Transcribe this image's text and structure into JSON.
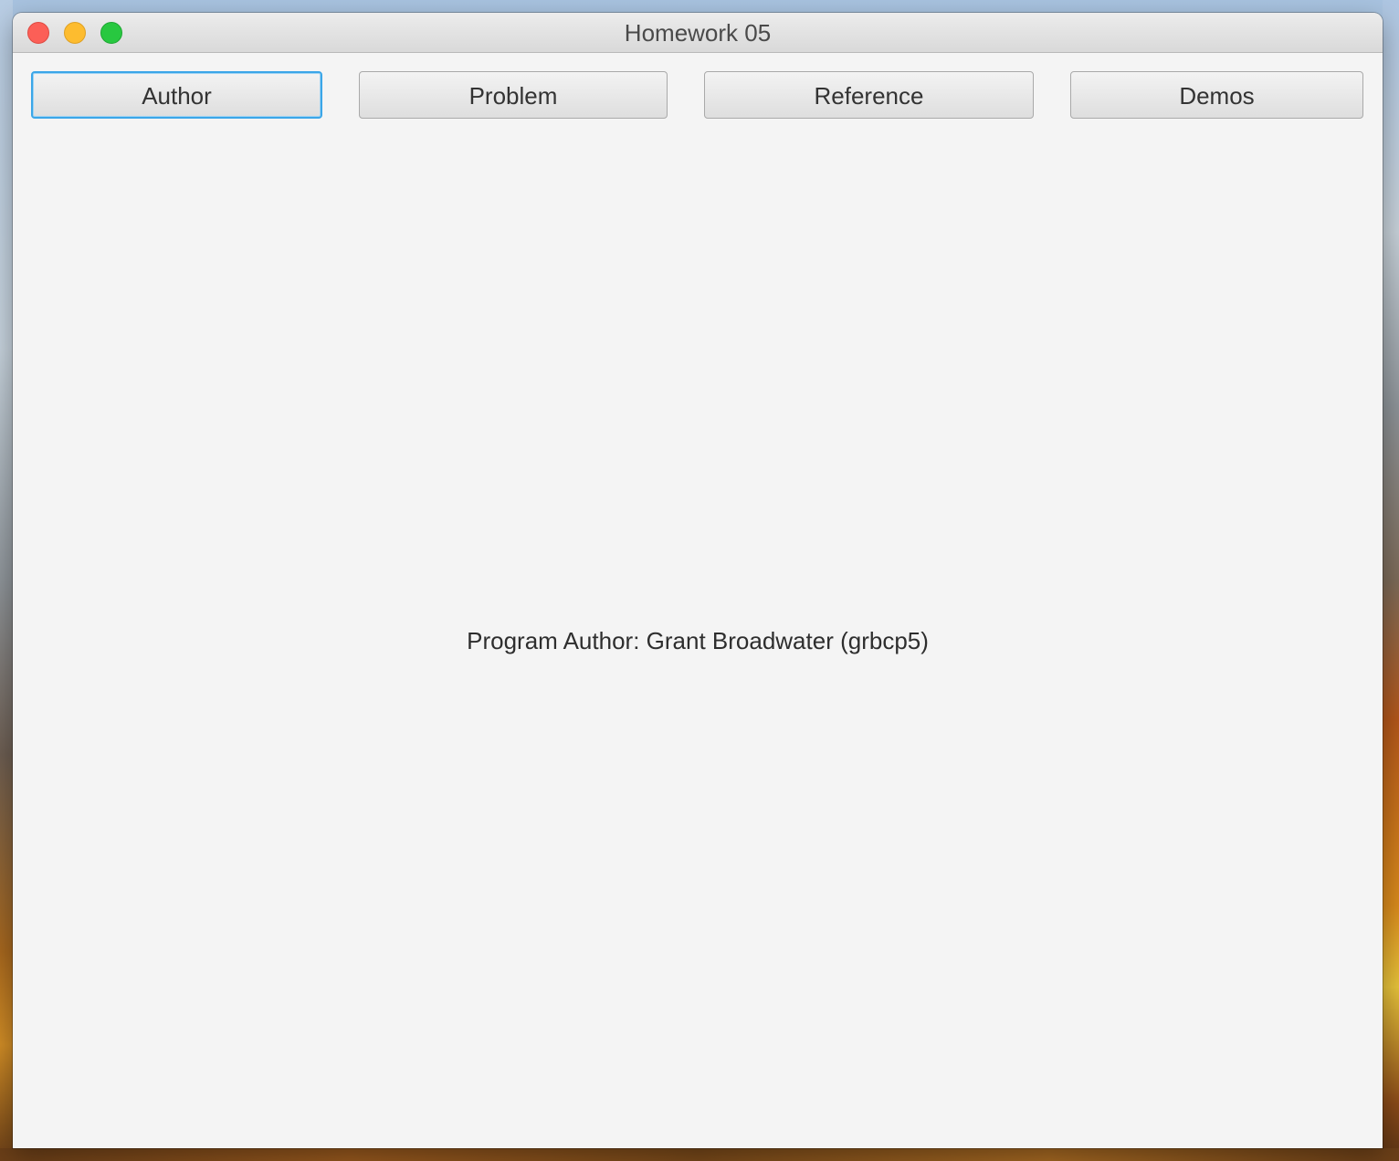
{
  "window": {
    "title": "Homework 05"
  },
  "toolbar": {
    "buttons": [
      {
        "label": "Author",
        "focused": true
      },
      {
        "label": "Problem",
        "focused": false
      },
      {
        "label": "Reference",
        "focused": false
      },
      {
        "label": "Demos",
        "focused": false
      }
    ]
  },
  "content": {
    "text": "Program Author: Grant Broadwater (grbcp5)"
  },
  "colors": {
    "focus_ring": "#3ba6e8",
    "close": "#fc5f57",
    "minimize": "#fdbc2f",
    "zoom": "#28c840"
  }
}
